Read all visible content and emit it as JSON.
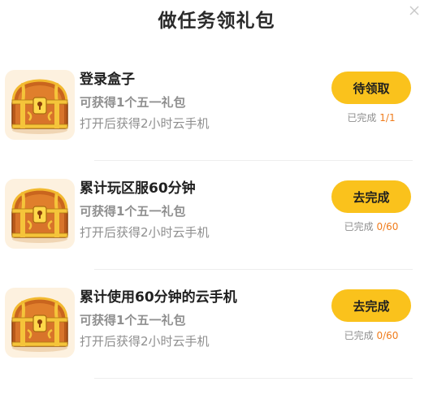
{
  "dialog": {
    "title": "做任务领礼包",
    "close_icon": "close-icon"
  },
  "tasks": [
    {
      "name": "登录盒子",
      "reward": "可获得1个五一礼包",
      "description": "打开后获得2小时云手机",
      "button_label": "待领取",
      "progress_label": "已完成",
      "progress_count": "1/1",
      "icon": "treasure-chest-icon"
    },
    {
      "name": "累计玩区服60分钟",
      "reward": "可获得1个五一礼包",
      "description": "打开后获得2小时云手机",
      "button_label": "去完成",
      "progress_label": "已完成",
      "progress_count": "0/60",
      "icon": "treasure-chest-icon"
    },
    {
      "name": "累计使用60分钟的云手机",
      "reward": "可获得1个五一礼包",
      "description": "打开后获得2小时云手机",
      "button_label": "去完成",
      "progress_label": "已完成",
      "progress_count": "0/60",
      "icon": "treasure-chest-icon"
    }
  ],
  "colors": {
    "button": "#fac21c",
    "progress_count": "#f07c1b",
    "muted_text": "#8f8f8f",
    "chest_tile": "#fdf1df"
  }
}
